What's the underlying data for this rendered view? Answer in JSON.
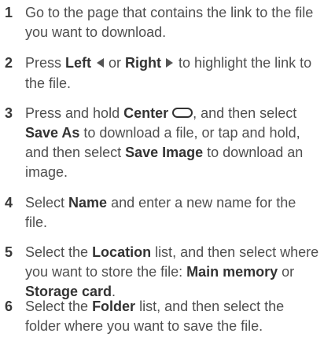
{
  "steps": [
    {
      "number": "1",
      "parts": [
        {
          "text": "Go to the page that contains the link to the file you want to download.",
          "bold": false
        }
      ]
    },
    {
      "number": "2",
      "parts": [
        {
          "text": "Press ",
          "bold": false
        },
        {
          "text": "Left",
          "bold": true
        },
        {
          "icon": "left-arrow-icon"
        },
        {
          "text": " or ",
          "bold": false
        },
        {
          "text": "Right",
          "bold": true
        },
        {
          "icon": "right-arrow-icon"
        },
        {
          "text": " to highlight the link to the file.",
          "bold": false
        }
      ]
    },
    {
      "number": "3",
      "parts": [
        {
          "text": "Press and hold ",
          "bold": false
        },
        {
          "text": "Center",
          "bold": true
        },
        {
          "icon": "center-button-icon"
        },
        {
          "text": ", and then select ",
          "bold": false
        },
        {
          "text": "Save As",
          "bold": true
        },
        {
          "text": " to download a file, or tap and hold, and then select ",
          "bold": false
        },
        {
          "text": "Save Image",
          "bold": true
        },
        {
          "text": " to download an image.",
          "bold": false
        }
      ]
    },
    {
      "number": "4",
      "parts": [
        {
          "text": "Select ",
          "bold": false
        },
        {
          "text": "Name",
          "bold": true
        },
        {
          "text": " and enter a new name for the file.",
          "bold": false
        }
      ]
    },
    {
      "number": "5",
      "parts": [
        {
          "text": "Select the ",
          "bold": false
        },
        {
          "text": "Location",
          "bold": true
        },
        {
          "text": " list, and then select where you want to store the file: ",
          "bold": false
        },
        {
          "text": "Main memory",
          "bold": true
        },
        {
          "text": " or ",
          "bold": false
        },
        {
          "text": "Storage card",
          "bold": true
        },
        {
          "text": ".",
          "bold": false
        }
      ]
    },
    {
      "number": "6",
      "parts": [
        {
          "text": "Select the ",
          "bold": false
        },
        {
          "text": "Folder",
          "bold": true
        },
        {
          "text": " list, and then select the folder where you want to save the file.",
          "bold": false
        }
      ]
    }
  ]
}
